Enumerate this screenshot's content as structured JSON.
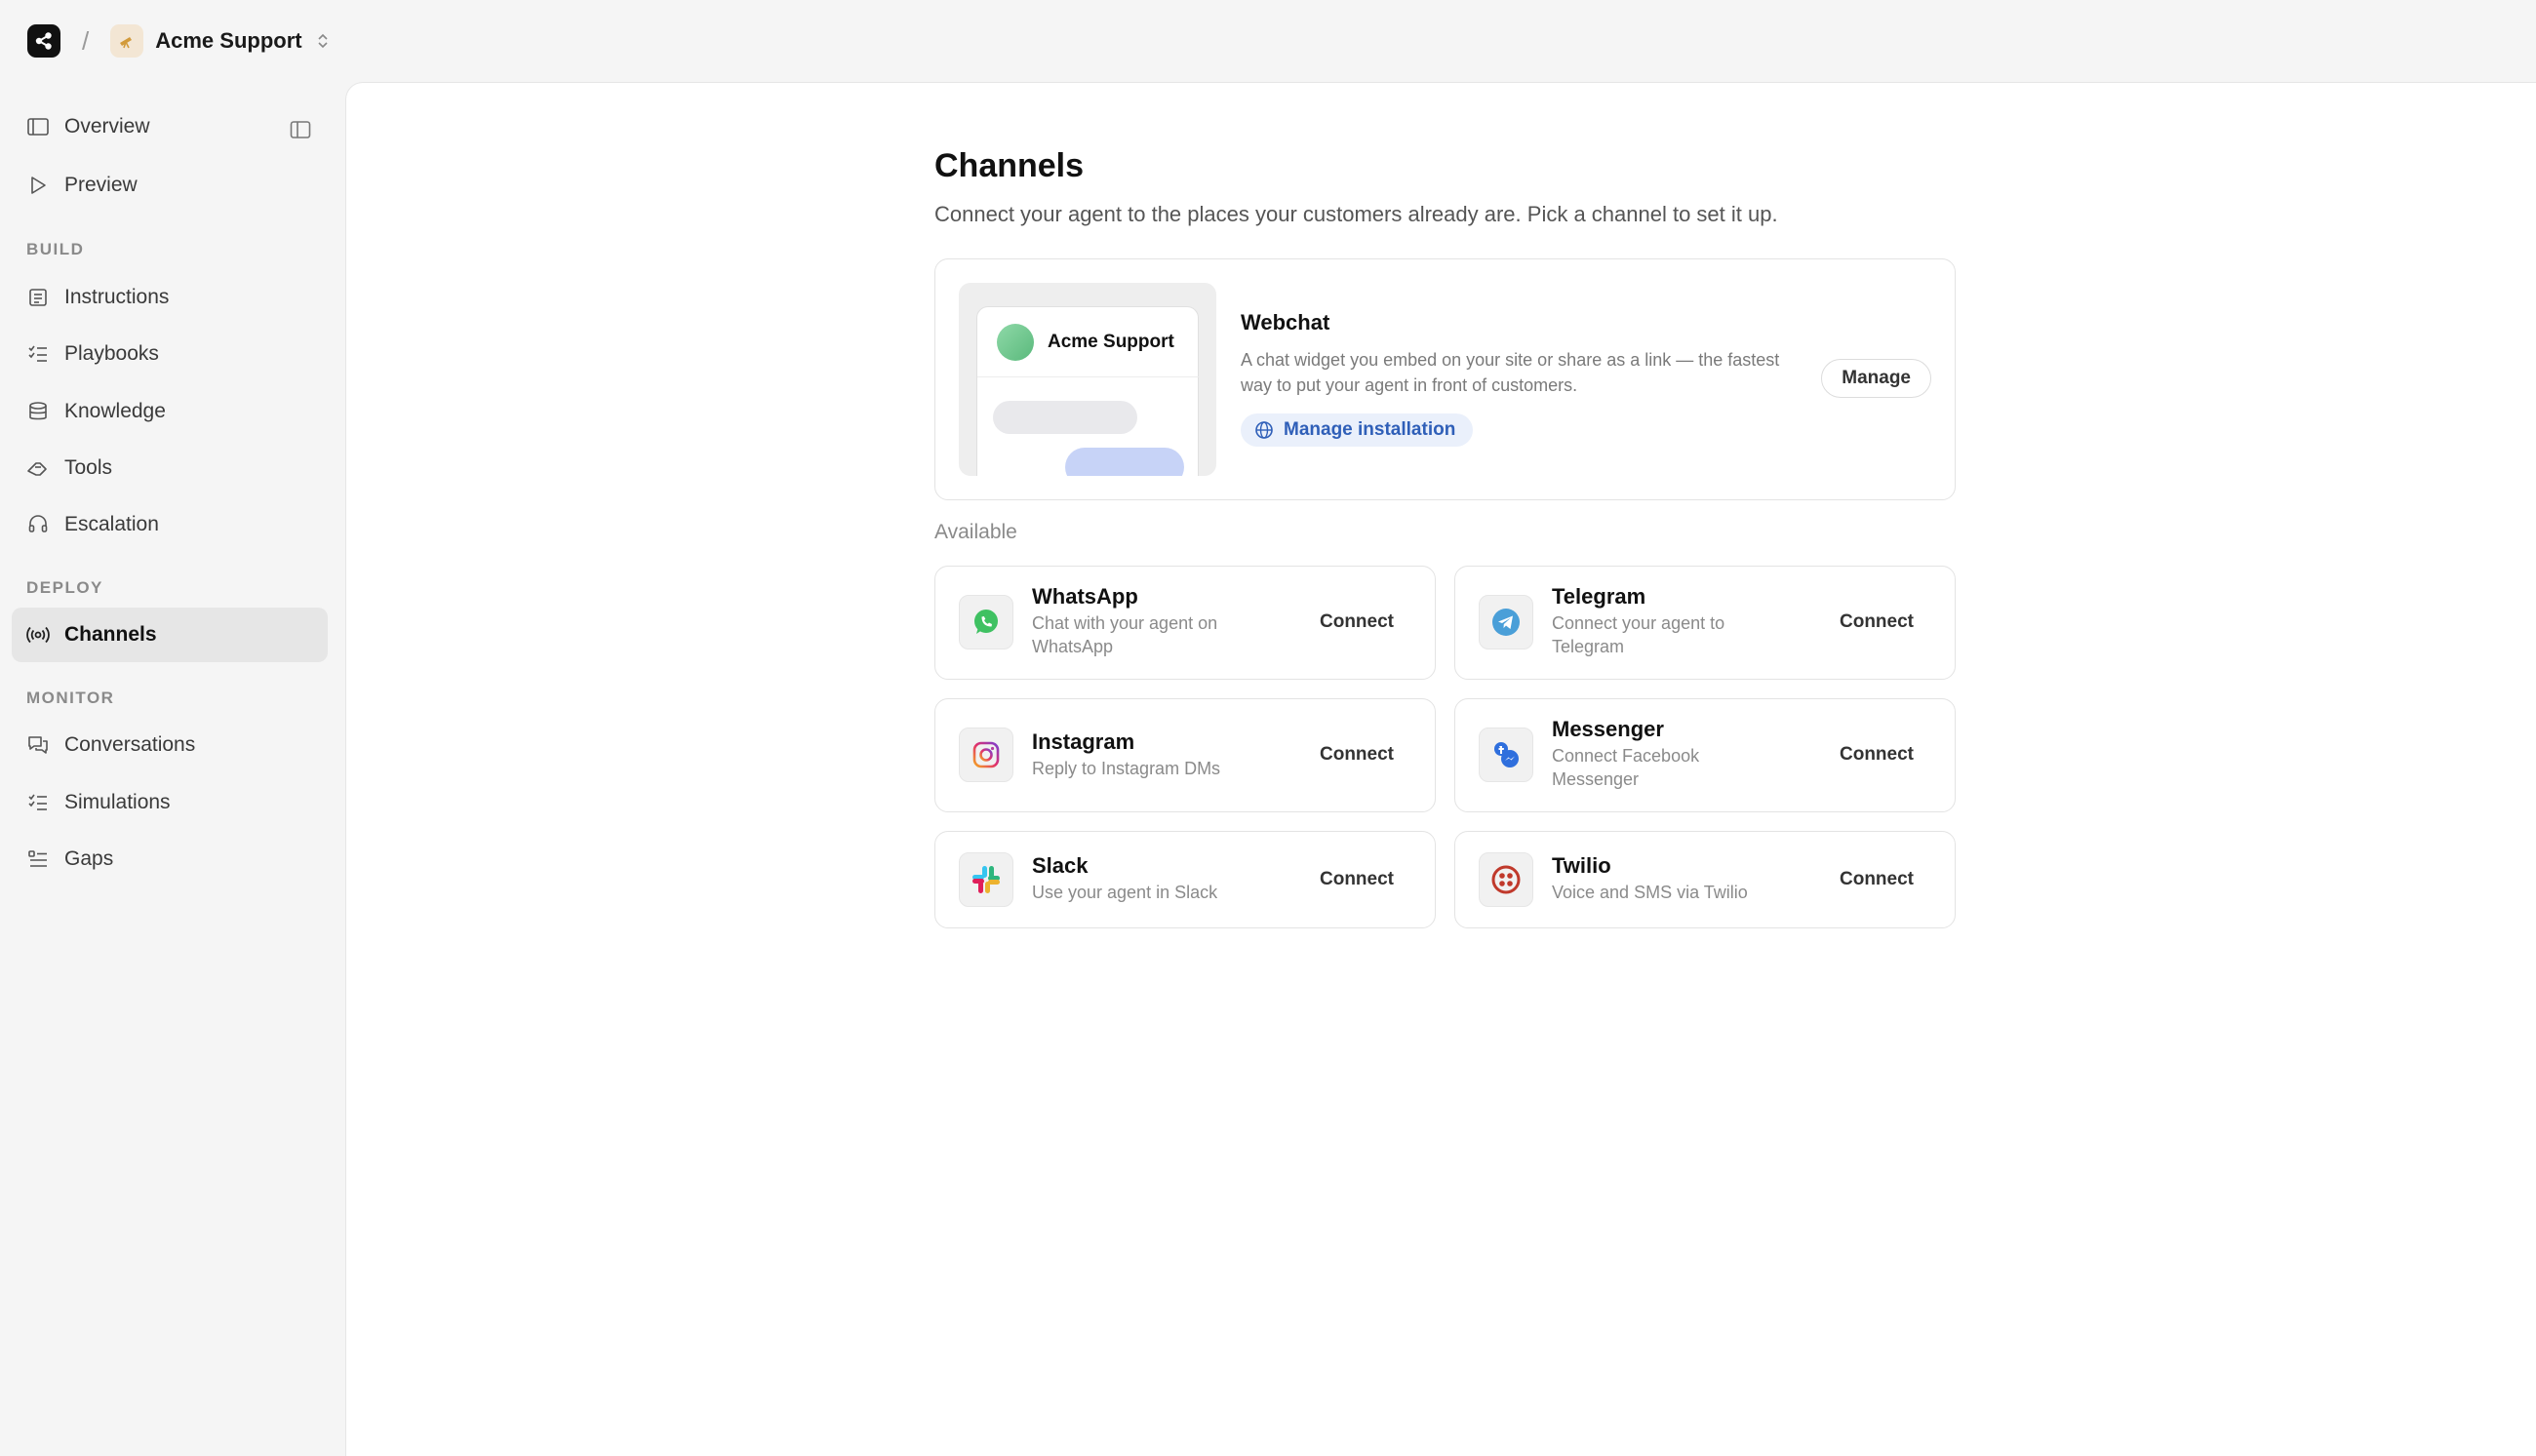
{
  "topbar": {
    "workspace_name": "Acme Support",
    "separator": "/"
  },
  "sidebar": {
    "top_items": [
      {
        "label": "Overview",
        "icon": "layout-icon"
      },
      {
        "label": "Preview",
        "icon": "play-icon"
      }
    ],
    "sections": [
      {
        "label": "BUILD",
        "items": [
          {
            "label": "Instructions",
            "icon": "script-icon"
          },
          {
            "label": "Playbooks",
            "icon": "checklist-icon"
          },
          {
            "label": "Knowledge",
            "icon": "database-icon"
          },
          {
            "label": "Tools",
            "icon": "tools-icon"
          },
          {
            "label": "Escalation",
            "icon": "headset-icon"
          }
        ]
      },
      {
        "label": "DEPLOY",
        "items": [
          {
            "label": "Channels",
            "icon": "broadcast-icon",
            "active": true
          }
        ]
      },
      {
        "label": "MONITOR",
        "items": [
          {
            "label": "Conversations",
            "icon": "chat-icon"
          },
          {
            "label": "Simulations",
            "icon": "checklist-icon"
          },
          {
            "label": "Gaps",
            "icon": "list-icon"
          }
        ]
      }
    ]
  },
  "main": {
    "title": "Channels",
    "subtitle": "Connect your agent to the places your customers already are. Pick a channel to set it up.",
    "webchat": {
      "preview_brand": "Acme Support",
      "title": "Webchat",
      "description": "A chat widget you embed on your site or share as a link — the fastest way to put your agent in front of customers.",
      "install_label": "Manage installation",
      "manage_label": "Manage"
    },
    "available_label": "Available",
    "channels": [
      {
        "name": "WhatsApp",
        "description": "Chat with your agent on WhatsApp",
        "action": "Connect",
        "icon": "whatsapp-icon",
        "color": "#25d366"
      },
      {
        "name": "Telegram",
        "description": "Connect your agent to Telegram",
        "action": "Connect",
        "icon": "telegram-icon",
        "color": "#2aabee"
      },
      {
        "name": "Instagram",
        "description": "Reply to Instagram DMs",
        "action": "Connect",
        "icon": "instagram-icon",
        "color": "#e1306c"
      },
      {
        "name": "Messenger",
        "description": "Connect Facebook Messenger",
        "action": "Connect",
        "icon": "messenger-icon",
        "color": "#2f6fdd"
      },
      {
        "name": "Slack",
        "description": "Use your agent in Slack",
        "action": "Connect",
        "icon": "slack-icon",
        "color": "#4a154b"
      },
      {
        "name": "Twilio",
        "description": "Voice and SMS via Twilio",
        "action": "Connect",
        "icon": "twilio-icon",
        "color": "#c0392b"
      }
    ]
  }
}
